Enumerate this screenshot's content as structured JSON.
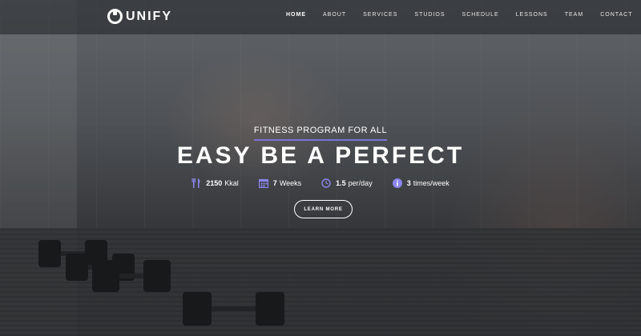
{
  "brand": {
    "logo_text": "UNIFY"
  },
  "nav": {
    "items": [
      {
        "label": "HOME",
        "active": true
      },
      {
        "label": "ABOUT"
      },
      {
        "label": "SERVICES"
      },
      {
        "label": "STUDIOS"
      },
      {
        "label": "SCHEDULE"
      },
      {
        "label": "LESSONS"
      },
      {
        "label": "TEAM"
      },
      {
        "label": "CONTACT"
      }
    ]
  },
  "hero": {
    "kicker": "FITNESS PROGRAM FOR ALL",
    "headline": "EASY BE A PERFECT",
    "stats": [
      {
        "icon": "cutlery-icon",
        "value": "2150",
        "unit": "Kkal"
      },
      {
        "icon": "calendar-icon",
        "value": "7",
        "unit": "Weeks"
      },
      {
        "icon": "clock-icon",
        "value": "1.5",
        "unit": "per/day"
      },
      {
        "icon": "info-icon",
        "value": "3",
        "unit": "times/week"
      }
    ],
    "cta_label": "LEARN MORE"
  },
  "colors": {
    "accent": "#7b72d9",
    "icon": "#8b86f0"
  }
}
